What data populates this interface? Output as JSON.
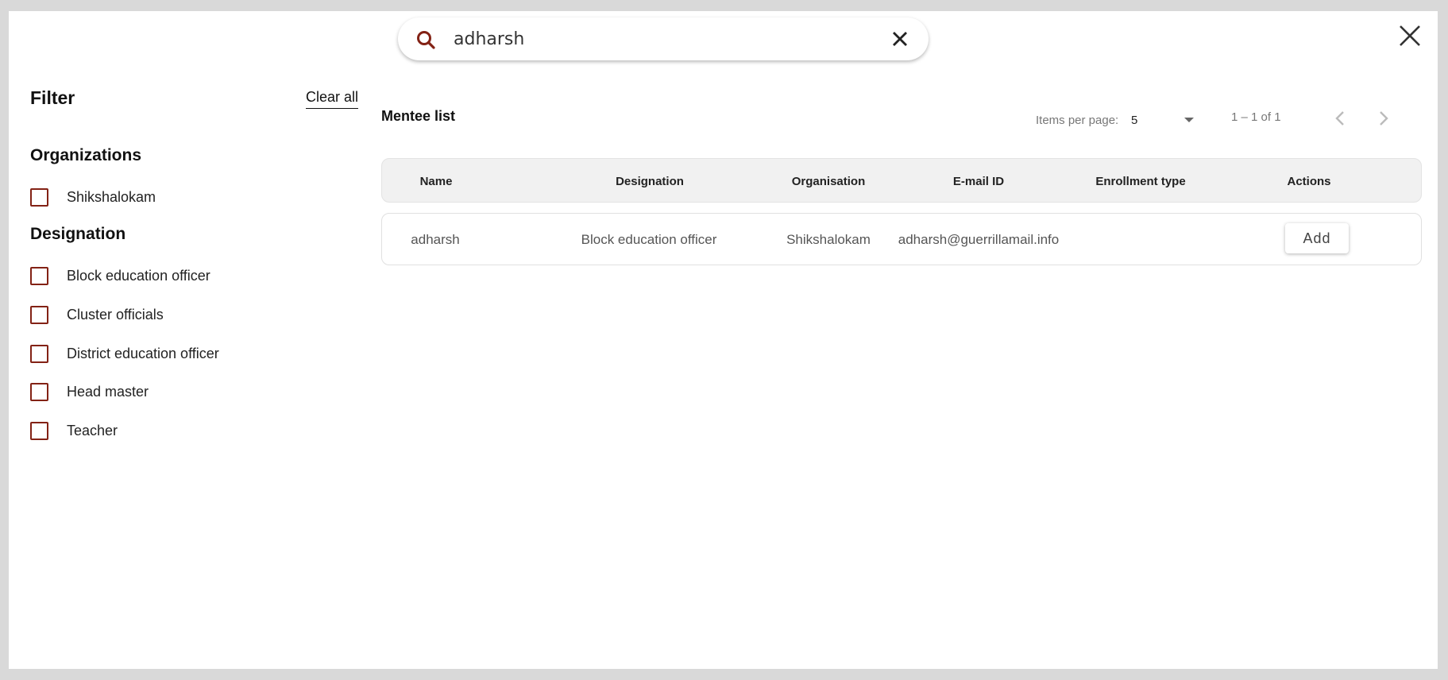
{
  "search": {
    "value": "adharsh",
    "search_icon": "search-icon",
    "clear_icon": "close-icon"
  },
  "dialog": {
    "close_icon": "close-icon"
  },
  "filter": {
    "title": "Filter",
    "clear_all_label": "Clear all",
    "groups": [
      {
        "title": "Organizations",
        "options": [
          {
            "label": "Shikshalokam",
            "checked": false
          }
        ]
      },
      {
        "title": "Designation",
        "options": [
          {
            "label": "Block education officer",
            "checked": false
          },
          {
            "label": "Cluster officials",
            "checked": false
          },
          {
            "label": "District education officer",
            "checked": false
          },
          {
            "label": "Head master",
            "checked": false
          },
          {
            "label": "Teacher",
            "checked": false
          }
        ]
      }
    ]
  },
  "list": {
    "title": "Mentee list",
    "items_per_page_label": "Items per page:",
    "items_per_page_value": "5",
    "range_label": "1 – 1 of 1",
    "columns": [
      "Name",
      "Designation",
      "Organisation",
      "E-mail ID",
      "Enrollment type",
      "Actions"
    ],
    "rows": [
      {
        "name": "adharsh",
        "designation": "Block education officer",
        "organisation": "Shikshalokam",
        "email": "adharsh@guerrillamail.info",
        "enrollment_type": "",
        "action_label": "Add"
      }
    ]
  },
  "colors": {
    "accent": "#832215",
    "header_bg": "#f1f1f1",
    "backdrop": "#d9d9d9"
  }
}
